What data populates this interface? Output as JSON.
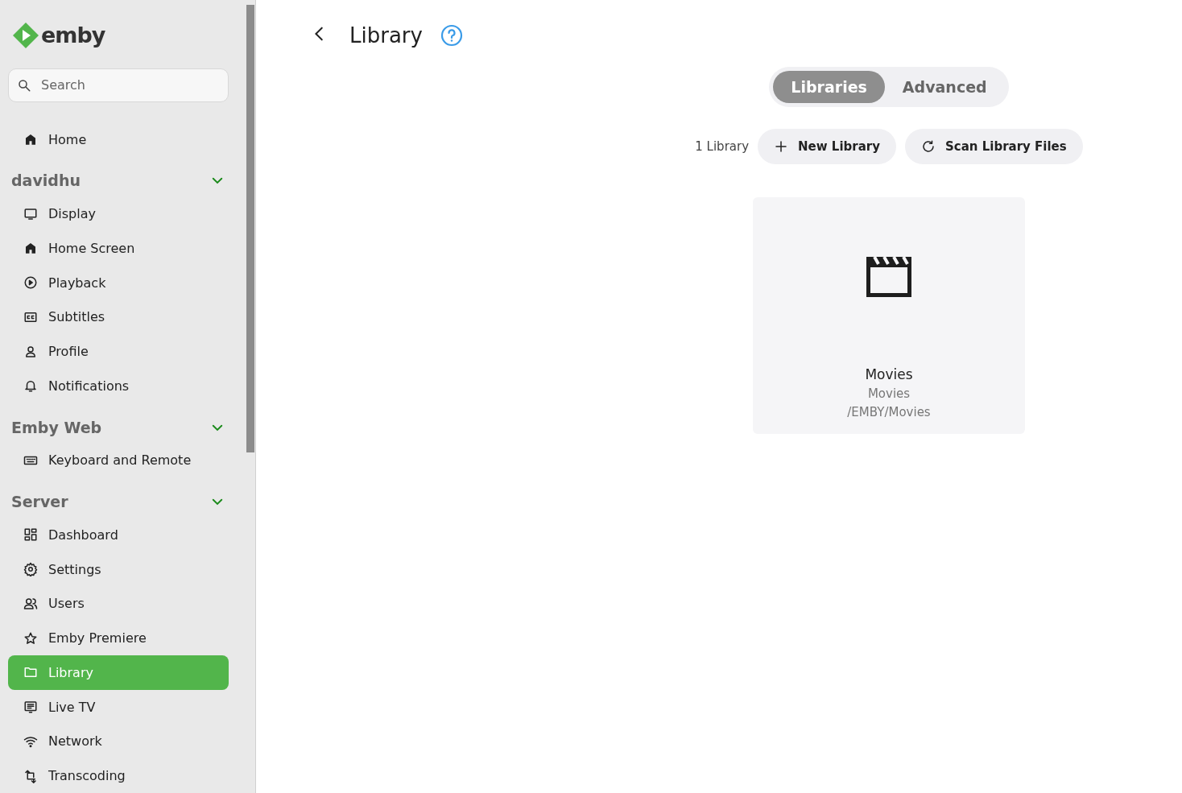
{
  "logo": {
    "text": "emby"
  },
  "search": {
    "placeholder": "Search"
  },
  "home": {
    "label": "Home",
    "selected": false
  },
  "sections": [
    {
      "title": "davidhu",
      "expanded": true,
      "items": [
        {
          "label": "Display",
          "selected": false
        },
        {
          "label": "Home Screen",
          "selected": false
        },
        {
          "label": "Playback",
          "selected": false
        },
        {
          "label": "Subtitles",
          "selected": false
        },
        {
          "label": "Profile",
          "selected": false
        },
        {
          "label": "Notifications",
          "selected": false
        }
      ]
    },
    {
      "title": "Emby Web",
      "expanded": true,
      "items": [
        {
          "label": "Keyboard and Remote",
          "selected": false
        }
      ]
    },
    {
      "title": "Server",
      "expanded": true,
      "items": [
        {
          "label": "Dashboard",
          "selected": false
        },
        {
          "label": "Settings",
          "selected": false
        },
        {
          "label": "Users",
          "selected": false
        },
        {
          "label": "Emby Premiere",
          "selected": false
        },
        {
          "label": "Library",
          "selected": true
        },
        {
          "label": "Live TV",
          "selected": false
        },
        {
          "label": "Network",
          "selected": false
        },
        {
          "label": "Transcoding",
          "selected": false
        }
      ]
    }
  ],
  "page": {
    "title": "Library"
  },
  "tabs": [
    {
      "label": "Libraries",
      "selected": true
    },
    {
      "label": "Advanced",
      "selected": false
    }
  ],
  "toolbar": {
    "count": "1 Library",
    "buttons": [
      {
        "kind": "add",
        "label": "New Library"
      },
      {
        "kind": "refresh",
        "label": "Scan Library Files"
      }
    ]
  },
  "libraries": [
    {
      "name": "Movies",
      "type": "Movies",
      "path": "/EMBY/Movies"
    }
  ]
}
